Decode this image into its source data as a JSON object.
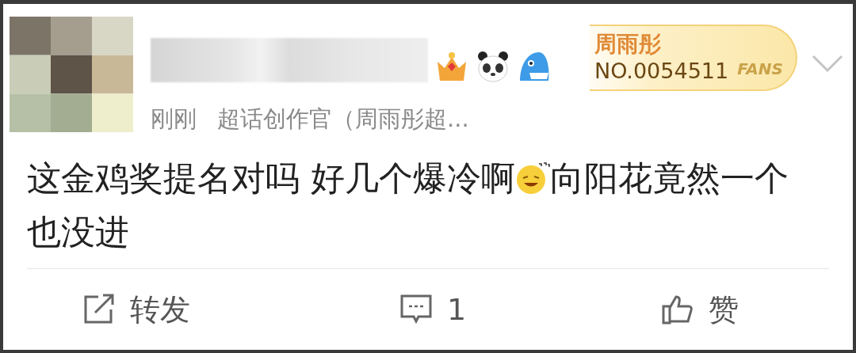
{
  "post": {
    "time": "刚刚",
    "source": "超话创作官（周雨彤超...",
    "fan_badge": {
      "name": "周雨彤",
      "number": "NO.0054511",
      "label": "FANS"
    },
    "body_before": "这金鸡奖提名对吗 好几个爆冷啊",
    "body_after": "向阳花竟然一个",
    "body_line_2": "也没进"
  },
  "actions": [
    {
      "kind": "repost",
      "label": "转发"
    },
    {
      "kind": "comment",
      "label": "1"
    },
    {
      "kind": "like",
      "label": "赞"
    }
  ]
}
